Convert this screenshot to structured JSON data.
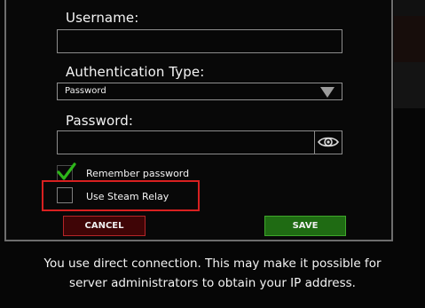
{
  "colors": {
    "background": "#060606",
    "dialog_border": "#6d6d6d",
    "highlight": "#d82020",
    "cancel_fill": "#3f0506",
    "cancel_border": "#b52528",
    "save_fill": "#1f6b13",
    "save_border": "#3ea62b",
    "checkmark": "#2db51a"
  },
  "form": {
    "username": {
      "label": "Username:",
      "value": ""
    },
    "authentication_type": {
      "label": "Authentication Type:",
      "value": "Password"
    },
    "password": {
      "label": "Password:",
      "value": "",
      "toggle_icon": "eye-icon"
    },
    "remember_password": {
      "label": "Remember password",
      "checked": true
    },
    "use_steam_relay": {
      "label": "Use Steam Relay",
      "checked": false
    }
  },
  "buttons": {
    "cancel": "CANCEL",
    "save": "SAVE"
  },
  "notice": {
    "line1": "You use direct connection. This may make it possible for",
    "line2": "server administrators to obtain your IP address."
  }
}
